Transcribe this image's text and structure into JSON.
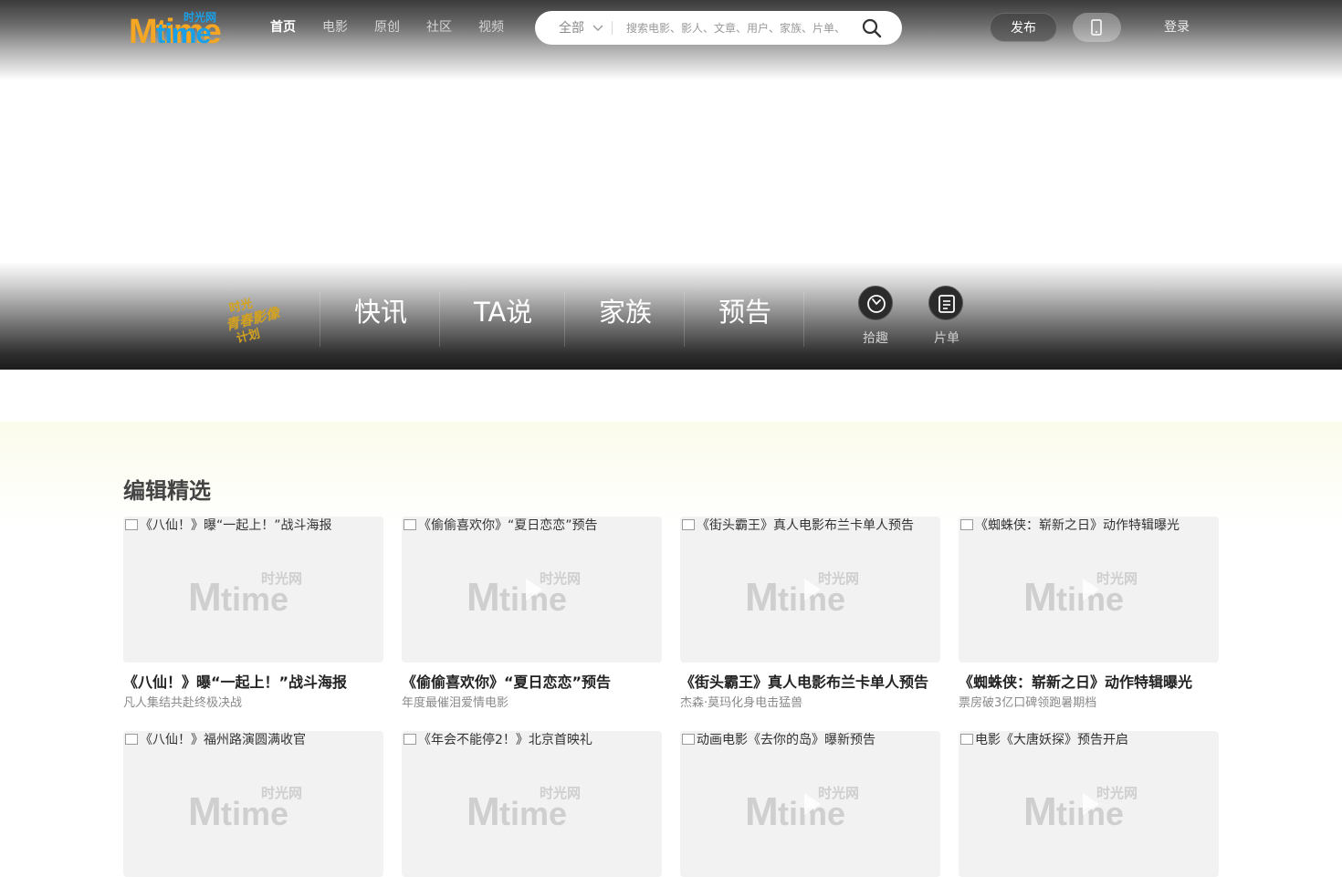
{
  "header": {
    "logo_main": "Mtime",
    "logo_cn": "时光网",
    "nav": [
      {
        "label": "首页",
        "active": true
      },
      {
        "label": "电影",
        "active": false
      },
      {
        "label": "原创",
        "active": false
      },
      {
        "label": "社区",
        "active": false
      },
      {
        "label": "视频",
        "active": false
      }
    ],
    "search": {
      "scope": "全部",
      "placeholder": "搜索电影、影人、文章、用户、家族、片单、"
    },
    "publish_label": "发布",
    "login_label": "登录"
  },
  "channel_bar": {
    "logo_text": "青春影像计划",
    "tabs": [
      "快讯",
      "TA说",
      "家族",
      "预告"
    ],
    "icons": [
      {
        "label": "拾趣",
        "icon": "compass-icon"
      },
      {
        "label": "片单",
        "icon": "list-icon"
      }
    ]
  },
  "picks": {
    "title": "编辑精选",
    "watermark_main": "Mtime",
    "watermark_cn": "时光网",
    "items": [
      {
        "alt": "《八仙！》曝“一起上！”战斗海报",
        "title": "《八仙！》曝“一起上！”战斗海报",
        "subtitle": "凡人集结共赴终极决战",
        "video": false
      },
      {
        "alt": "《偷偷喜欢你》“夏日恋恋”预告",
        "title": "《偷偷喜欢你》“夏日恋恋”预告",
        "subtitle": "年度最催泪爱情电影",
        "video": true
      },
      {
        "alt": "《街头霸王》真人电影布兰卡单人预告",
        "title": "《街头霸王》真人电影布兰卡单人预告",
        "subtitle": "杰森·莫玛化身电击猛兽",
        "video": true
      },
      {
        "alt": "《蜘蛛侠：崭新之日》动作特辑曝光",
        "title": "《蜘蛛侠：崭新之日》动作特辑曝光",
        "subtitle": "票房破3亿口碑领跑暑期档",
        "video": true
      },
      {
        "alt": "《八仙！》福州路演圆满收官",
        "title": "",
        "subtitle": "",
        "video": false
      },
      {
        "alt": "《年会不能停2！》北京首映礼",
        "title": "",
        "subtitle": "",
        "video": false
      },
      {
        "alt": "动画电影《去你的岛》曝新预告",
        "title": "",
        "subtitle": "",
        "video": true
      },
      {
        "alt": "电影《大唐妖探》预告开启",
        "title": "",
        "subtitle": "",
        "video": true
      }
    ]
  },
  "colors": {
    "logo_orange": "#f5a623",
    "logo_blue": "#1aa0e8",
    "watermark": "#cfcfcf",
    "youth_gold": "#d4a21e"
  }
}
